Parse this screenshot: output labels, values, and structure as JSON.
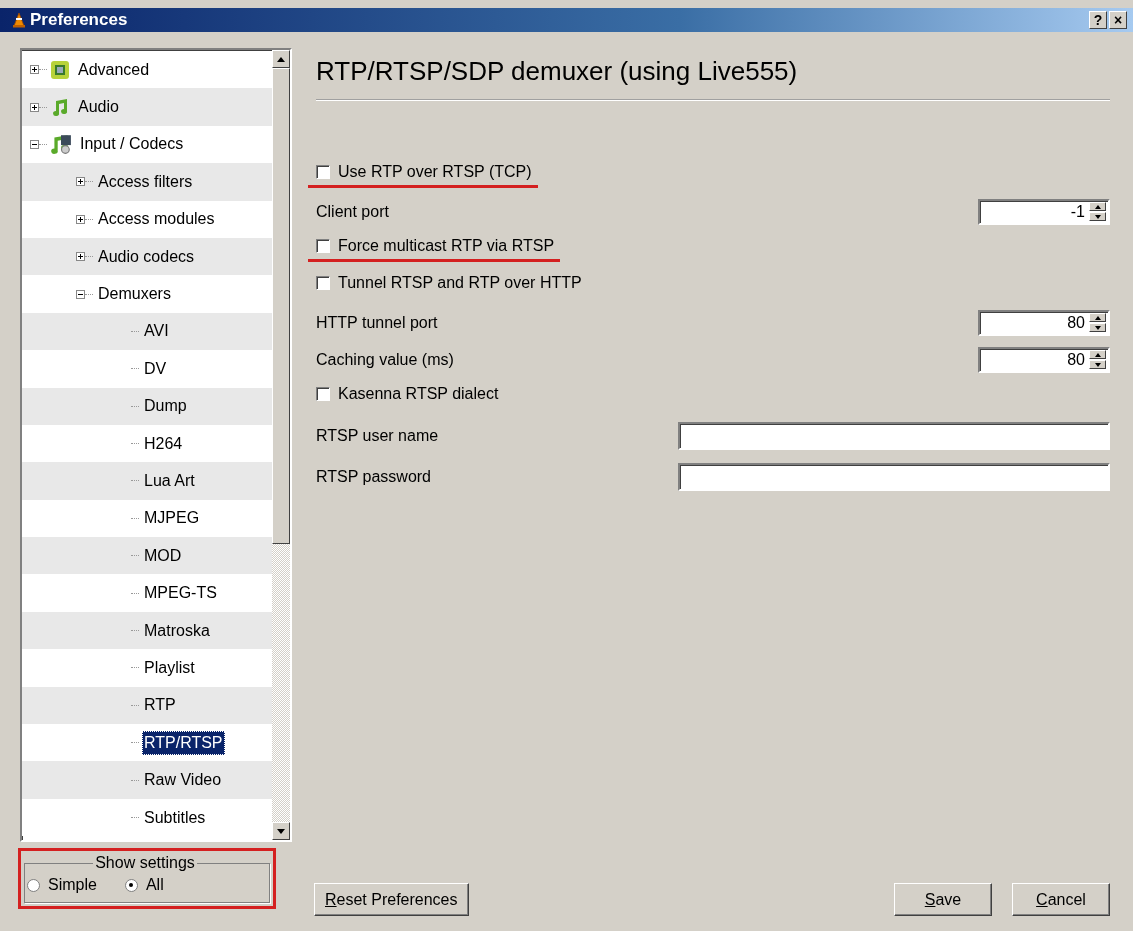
{
  "window": {
    "title": "Preferences",
    "help_button": "?",
    "close_button": "×"
  },
  "tree": [
    {
      "label": "Advanced",
      "expanded": false,
      "selected": false
    },
    {
      "label": "Audio",
      "expanded": false,
      "selected": false
    },
    {
      "label": "Input / Codecs",
      "expanded": true,
      "selected": false,
      "children": [
        {
          "label": "Access filters",
          "expanded": false,
          "selected": false
        },
        {
          "label": "Access modules",
          "expanded": false,
          "selected": false
        },
        {
          "label": "Audio codecs",
          "expanded": false,
          "selected": false
        },
        {
          "label": "Demuxers",
          "expanded": true,
          "selected": false,
          "children": [
            {
              "label": "AVI",
              "selected": false
            },
            {
              "label": "DV",
              "selected": false
            },
            {
              "label": "Dump",
              "selected": false
            },
            {
              "label": "H264",
              "selected": false
            },
            {
              "label": "Lua Art",
              "selected": false
            },
            {
              "label": "MJPEG",
              "selected": false
            },
            {
              "label": "MOD",
              "selected": false
            },
            {
              "label": "MPEG-TS",
              "selected": false
            },
            {
              "label": "Matroska",
              "selected": false
            },
            {
              "label": "Playlist",
              "selected": false
            },
            {
              "label": "RTP",
              "selected": false
            },
            {
              "label": "RTP/RTSP",
              "selected": true
            },
            {
              "label": "Raw Video",
              "selected": false
            },
            {
              "label": "Subtitles",
              "selected": false
            }
          ]
        }
      ]
    }
  ],
  "show_settings": {
    "title": "Show settings",
    "annotated": true,
    "options": [
      {
        "label": "Simple",
        "selected": false
      },
      {
        "label": "All",
        "selected": true
      }
    ]
  },
  "panel": {
    "title": "RTP/RTSP/SDP demuxer (using Live555)"
  },
  "options": [
    {
      "kind": "checkbox",
      "label": "Use RTP over RTSP (TCP)",
      "checked": false,
      "annotated": true
    },
    {
      "kind": "spin",
      "label": "Client port",
      "value": "-1"
    },
    {
      "kind": "checkbox",
      "label": "Force multicast RTP via RTSP",
      "checked": false,
      "annotated": true
    },
    {
      "kind": "checkbox",
      "label": "Tunnel RTSP and RTP over HTTP",
      "checked": false,
      "annotated": false
    },
    {
      "kind": "spin",
      "label": "HTTP tunnel port",
      "value": "80"
    },
    {
      "kind": "spin",
      "label": "Caching value (ms)",
      "value": "80"
    },
    {
      "kind": "checkbox",
      "label": "Kasenna RTSP dialect",
      "checked": false,
      "annotated": false
    },
    {
      "kind": "text",
      "label": "RTSP user name"
    },
    {
      "kind": "text",
      "label": "RTSP password"
    }
  ],
  "buttons": {
    "reset": "Reset Preferences",
    "save": "Save",
    "cancel": "Cancel"
  }
}
